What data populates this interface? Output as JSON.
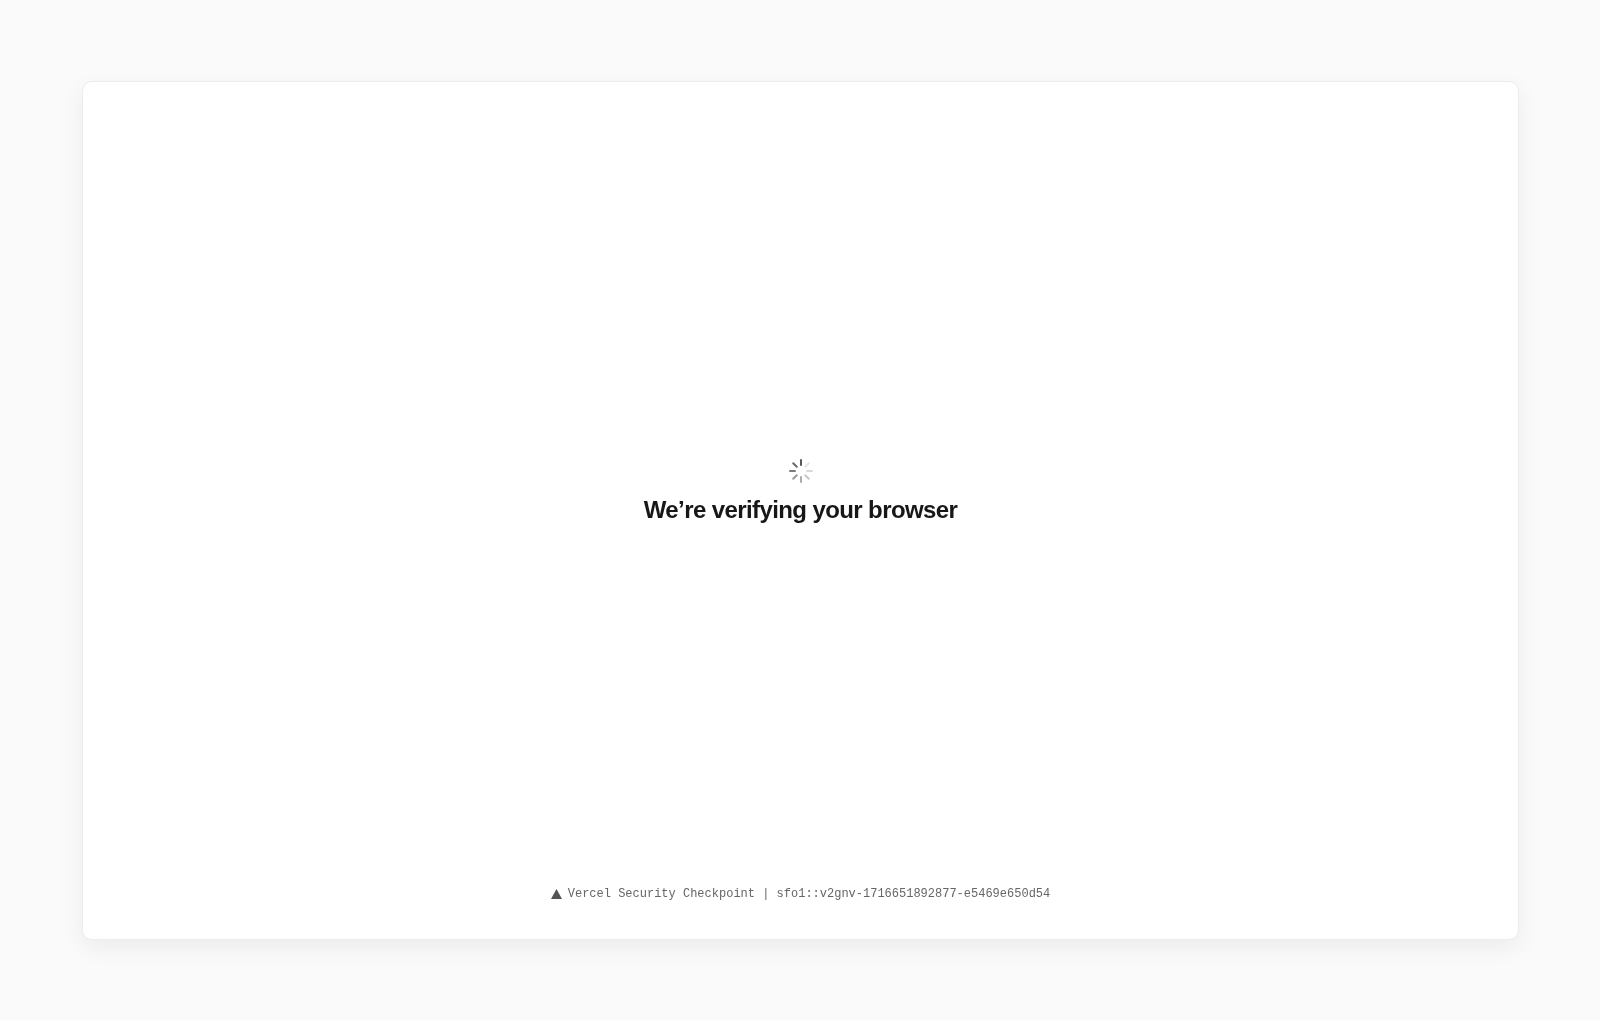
{
  "heading": "We’re verifying your browser",
  "footer": {
    "text": "Vercel Security Checkpoint | sfo1::v2gnv-1716651892877-e5469e650d54"
  }
}
